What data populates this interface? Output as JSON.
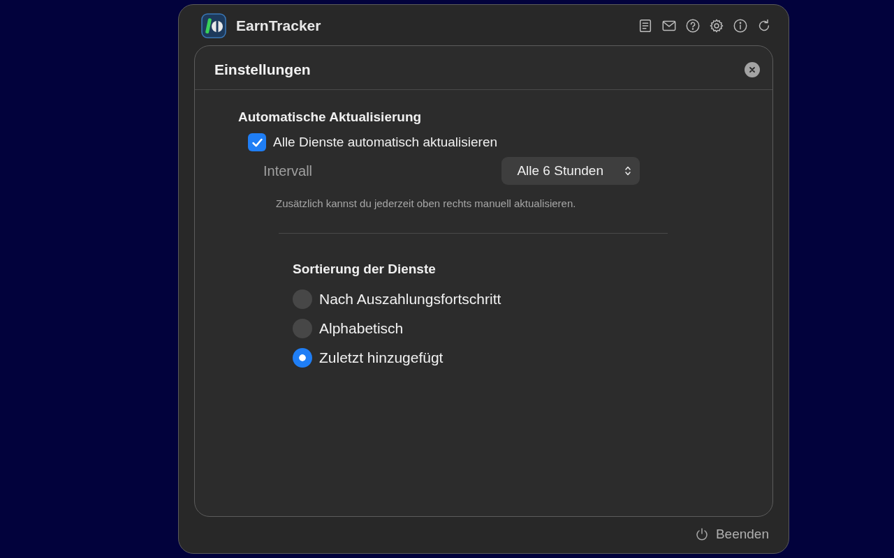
{
  "header": {
    "title": "EarnTracker"
  },
  "settings": {
    "title": "Einstellungen",
    "auto_update": {
      "heading": "Automatische Aktualisierung",
      "checkbox": {
        "label": "Alle Dienste automatisch aktualisieren",
        "checked": true
      },
      "interval": {
        "label": "Intervall",
        "value": "Alle 6 Stunden"
      },
      "hint": "Zusätzlich kannst du jederzeit oben rechts manuell aktualisieren."
    },
    "sorting": {
      "heading": "Sortierung der Dienste",
      "options": [
        {
          "label": "Nach Auszahlungsfortschritt",
          "selected": false
        },
        {
          "label": "Alphabetisch",
          "selected": false
        },
        {
          "label": "Zuletzt hinzugefügt",
          "selected": true
        }
      ]
    }
  },
  "footer": {
    "quit": "Beenden"
  }
}
